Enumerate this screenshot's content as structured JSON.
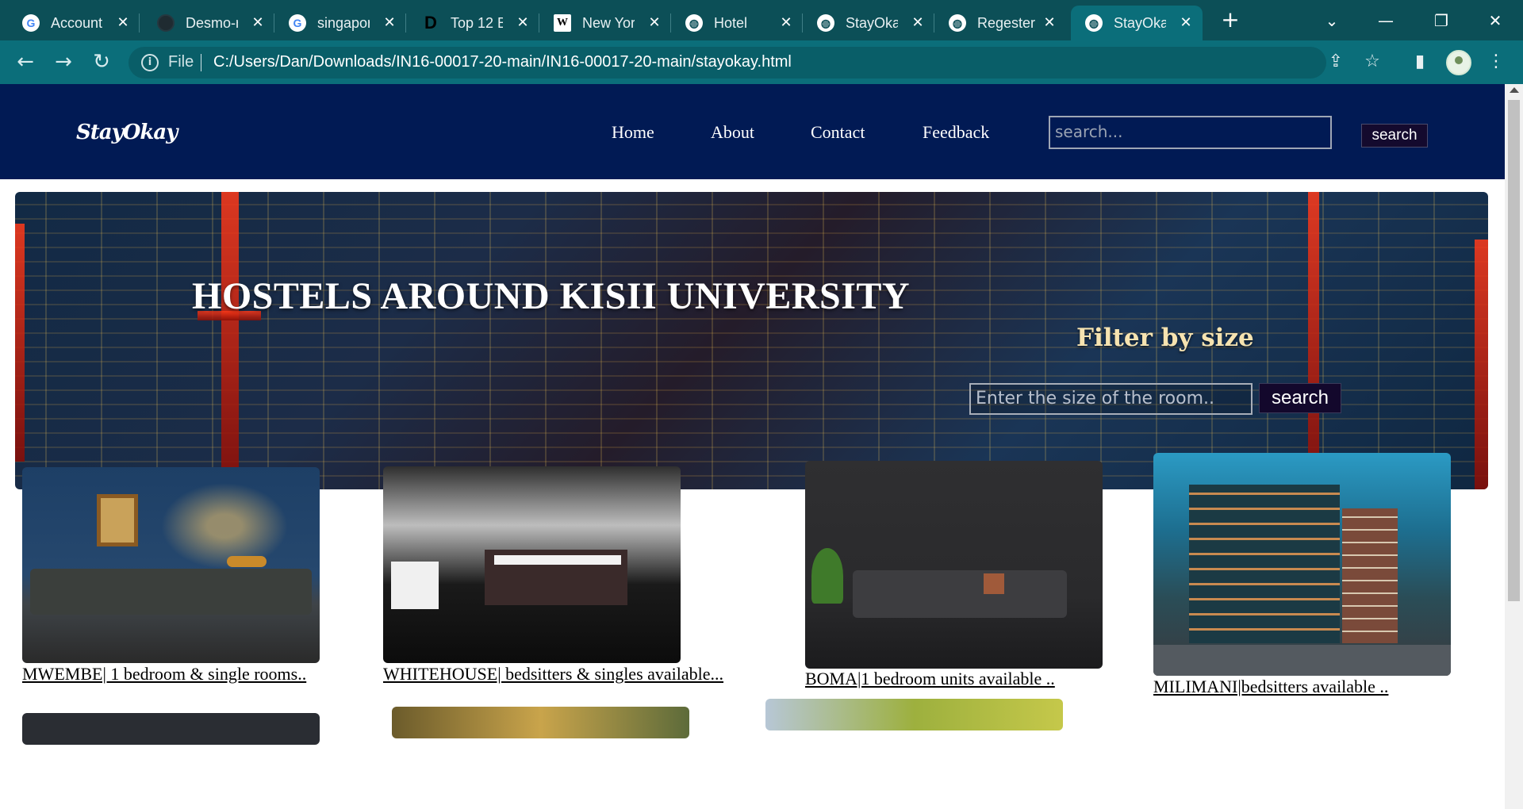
{
  "browser": {
    "tabs": [
      {
        "title": "Account",
        "icon": "google-icon"
      },
      {
        "title": "Desmo-r",
        "icon": "github-icon"
      },
      {
        "title": "singapor",
        "icon": "google-icon"
      },
      {
        "title": "Top 12 B",
        "icon": "dev-icon"
      },
      {
        "title": "New Yor",
        "icon": "wikipedia-icon"
      },
      {
        "title": "Hotel",
        "icon": "globe-icon"
      },
      {
        "title": "StayOkay",
        "icon": "globe-icon"
      },
      {
        "title": "Regester",
        "icon": "globe-icon"
      },
      {
        "title": "StayOkay",
        "icon": "globe-icon"
      }
    ],
    "active_tab_index": 8,
    "address": {
      "scheme_label": "File",
      "url": "C:/Users/Dan/Downloads/IN16-00017-20-main/IN16-00017-20-main/stayokay.html"
    },
    "colors": {
      "frame": "#0c4f57",
      "toolbar": "#0b6e7a"
    }
  },
  "site": {
    "logo": "StayOkay",
    "nav": [
      "Home",
      "About",
      "Contact",
      "Feedback"
    ],
    "search_placeholder": "search...",
    "search_button": "search",
    "colors": {
      "nav_bg": "#011a54"
    }
  },
  "hero": {
    "title": "HOSTELS AROUND KISII UNIVERSITY",
    "filter_title": "Filter by size",
    "filter_placeholder": "Enter the size of the room..",
    "filter_button": "search"
  },
  "listings": [
    {
      "label": "MWEMBE| 1 bedroom & single rooms..",
      "image": "bedroom-photo"
    },
    {
      "label": "WHITEHOUSE| bedsitters & singles available...",
      "image": "bedroom-photo"
    },
    {
      "label": "BOMA|1 bedroom units available ..",
      "image": "living-room-photo"
    },
    {
      "label": "MILIMANI|bedsitters available ..",
      "image": "apartment-building-photo"
    }
  ]
}
